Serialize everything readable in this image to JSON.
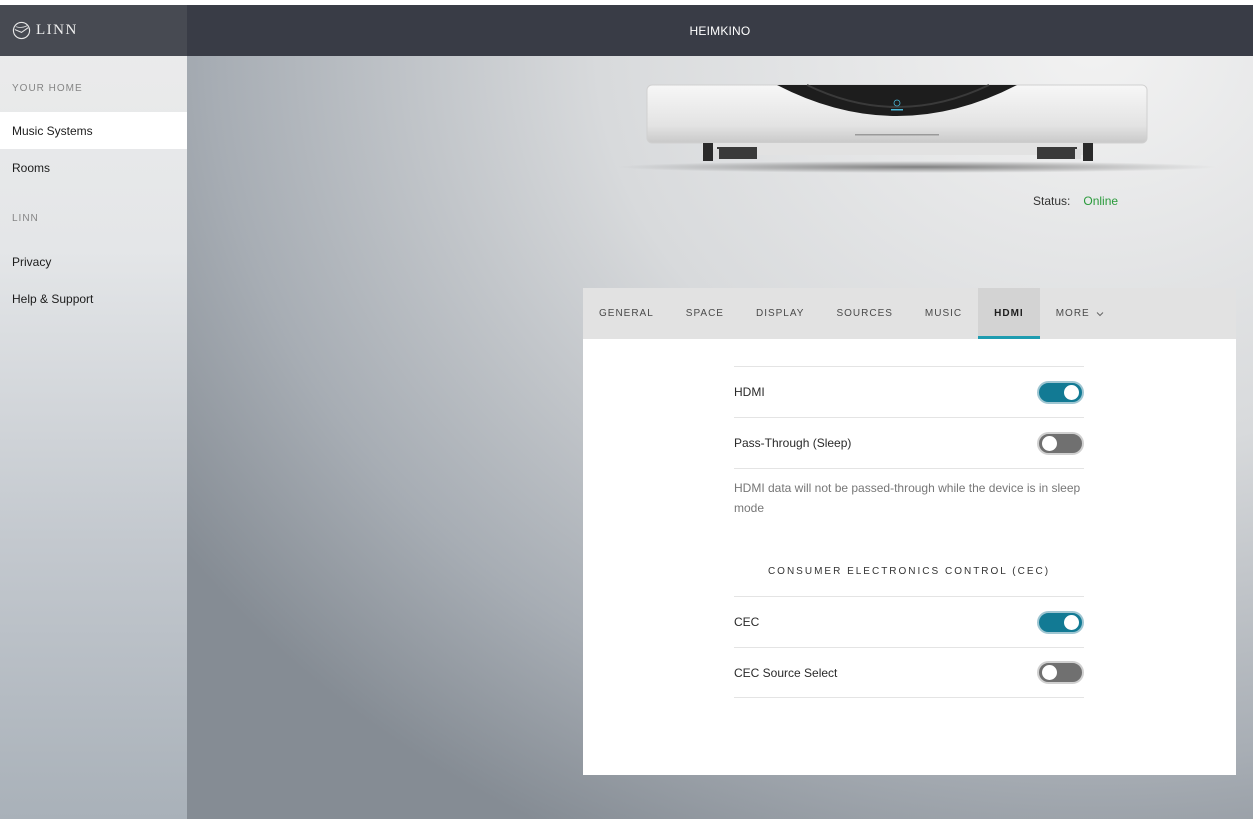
{
  "brand": {
    "logo_text": "LINN"
  },
  "sidebar": {
    "sections": [
      {
        "heading": "YOUR HOME",
        "items": [
          {
            "label": "Music Systems",
            "active": true
          },
          {
            "label": "Rooms",
            "active": false
          }
        ]
      },
      {
        "heading": "LINN",
        "items": [
          {
            "label": "Privacy",
            "active": false
          },
          {
            "label": "Help & Support",
            "active": false
          }
        ]
      }
    ]
  },
  "header": {
    "title": "HEIMKINO"
  },
  "device": {
    "status_label": "Status:",
    "status_value": "Online",
    "status_color": "#2a9a3b"
  },
  "tabs": [
    {
      "label": "GENERAL",
      "active": false
    },
    {
      "label": "SPACE",
      "active": false
    },
    {
      "label": "DISPLAY",
      "active": false
    },
    {
      "label": "SOURCES",
      "active": false
    },
    {
      "label": "MUSIC",
      "active": false
    },
    {
      "label": "HDMI",
      "active": true
    },
    {
      "label": "MORE",
      "active": false,
      "icon": "chevron-down-icon"
    }
  ],
  "hdmi": {
    "hdmi_label": "HDMI",
    "hdmi_on": true,
    "passthrough_label": "Pass-Through (Sleep)",
    "passthrough_on": false,
    "passthrough_help": "HDMI data will not be passed-through while the device is in sleep mode",
    "cec_heading": "CONSUMER ELECTRONICS CONTROL (CEC)",
    "cec_label": "CEC",
    "cec_on": true,
    "cec_source_label": "CEC Source Select",
    "cec_source_on": false
  },
  "colors": {
    "accent": "#1e9cb0",
    "toggle_on": "#127a94",
    "header_bg": "#393c46"
  }
}
